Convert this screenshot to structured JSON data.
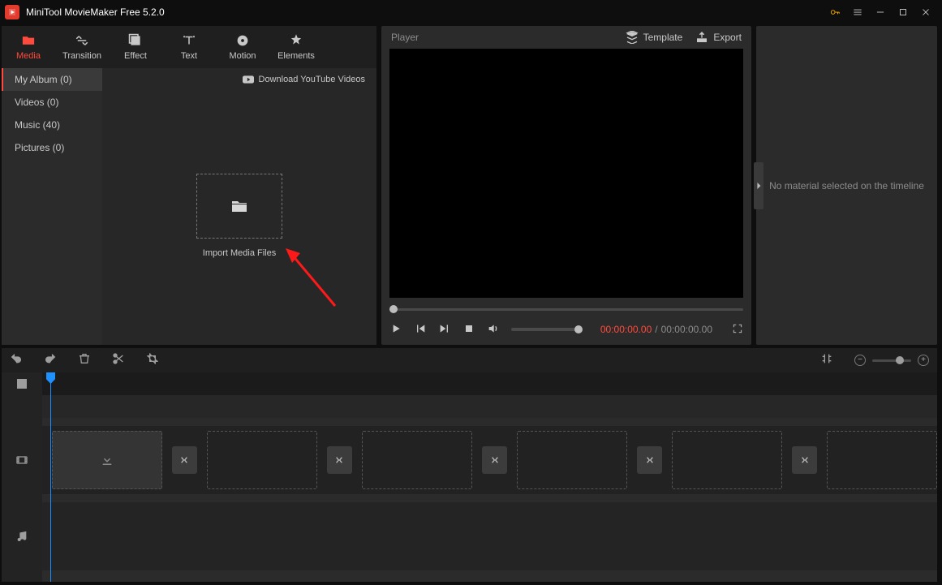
{
  "title": "MiniTool MovieMaker Free 5.2.0",
  "toptabs": {
    "media": "Media",
    "transition": "Transition",
    "effect": "Effect",
    "text": "Text",
    "motion": "Motion",
    "elements": "Elements"
  },
  "media_sidebar": {
    "my_album": "My Album (0)",
    "videos": "Videos (0)",
    "music": "Music (40)",
    "pictures": "Pictures (0)"
  },
  "download_yt": "Download YouTube Videos",
  "import_label": "Import Media Files",
  "player_label": "Player",
  "template_label": "Template",
  "export_label": "Export",
  "timecode": {
    "current": "00:00:00.00",
    "total": "00:00:00.00"
  },
  "side_panel_msg": "No material selected on the timeline"
}
